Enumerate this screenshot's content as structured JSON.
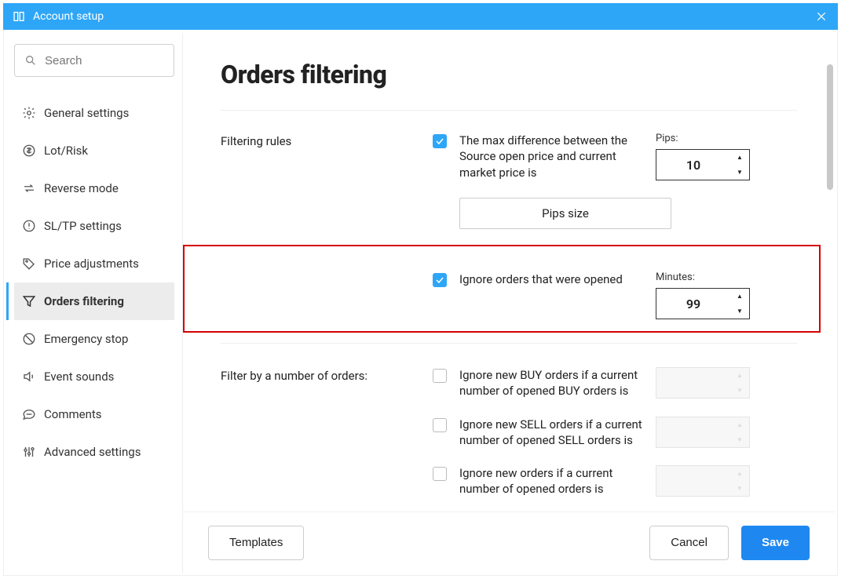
{
  "window": {
    "title": "Account setup"
  },
  "sidebar": {
    "search_placeholder": "Search",
    "items": [
      {
        "id": "general",
        "label": "General settings",
        "icon": "gear"
      },
      {
        "id": "lotrisk",
        "label": "Lot/Risk",
        "icon": "dollar"
      },
      {
        "id": "reverse",
        "label": "Reverse mode",
        "icon": "reverse"
      },
      {
        "id": "sltp",
        "label": "SL/TP settings",
        "icon": "alert"
      },
      {
        "id": "price",
        "label": "Price adjustments",
        "icon": "tag"
      },
      {
        "id": "orders",
        "label": "Orders filtering",
        "icon": "funnel",
        "active": true
      },
      {
        "id": "emerg",
        "label": "Emergency stop",
        "icon": "nosign"
      },
      {
        "id": "sounds",
        "label": "Event sounds",
        "icon": "speaker"
      },
      {
        "id": "comments",
        "label": "Comments",
        "icon": "chat"
      },
      {
        "id": "adv",
        "label": "Advanced settings",
        "icon": "sliders"
      }
    ]
  },
  "page": {
    "title": "Orders filtering",
    "section_filtering_rules_label": "Filtering rules",
    "rule_max_diff": {
      "checked": true,
      "text": "The max difference between the Source open price and current market price is",
      "num_label": "Pips:",
      "value": "10",
      "pips_button_label": "Pips size"
    },
    "rule_ignore_opened": {
      "checked": true,
      "text": "Ignore orders that were opened",
      "num_label": "Minutes:",
      "value": "99"
    },
    "section_filter_count_label": "Filter by a number of orders:",
    "rule_buy": {
      "checked": false,
      "text": "Ignore new BUY orders if a current number of opened BUY orders is",
      "value": ""
    },
    "rule_sell": {
      "checked": false,
      "text": "Ignore new SELL orders if a current number of opened SELL orders is",
      "value": ""
    },
    "rule_any": {
      "checked": false,
      "text": "Ignore new orders if a current number of opened orders is",
      "value": ""
    }
  },
  "footer": {
    "templates_label": "Templates",
    "cancel_label": "Cancel",
    "save_label": "Save"
  }
}
